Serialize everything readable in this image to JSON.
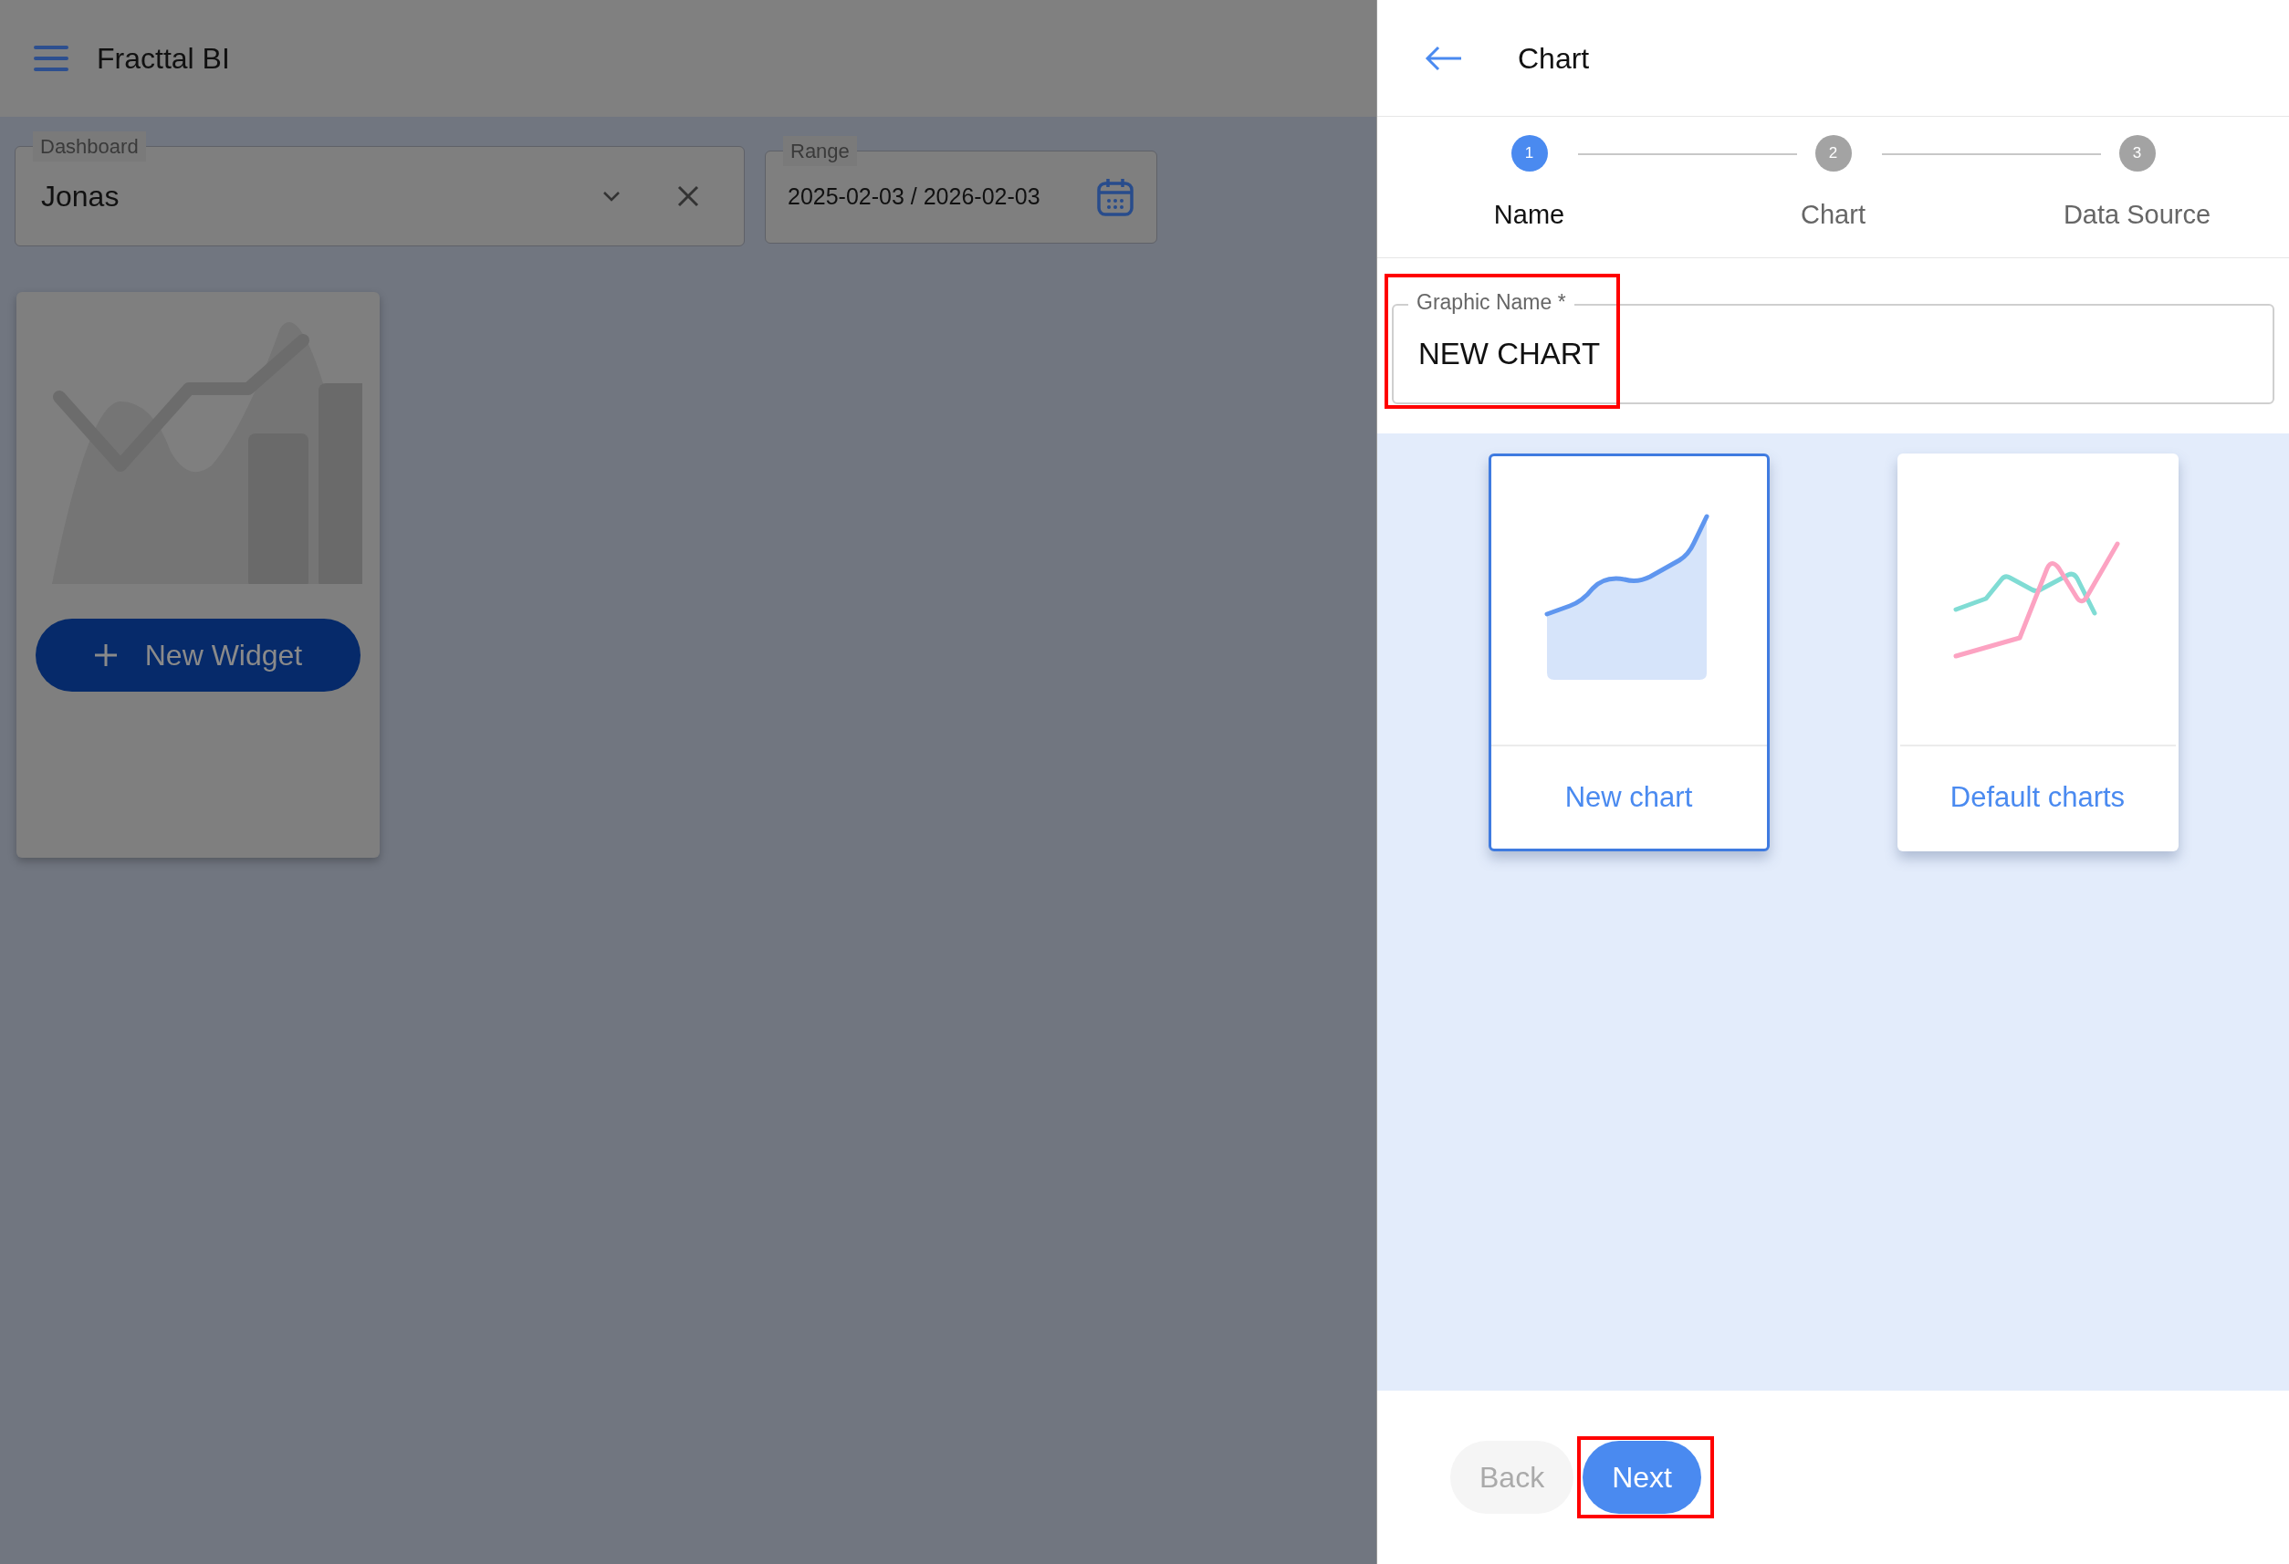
{
  "app": {
    "title": "Fracttal BI"
  },
  "filters": [
    {
      "label": "Dashboard",
      "value": "Jonas",
      "kind": "select"
    },
    {
      "label": "Range",
      "value": "2025-02-03 / 2026-02-03",
      "kind": "date"
    }
  ],
  "widget_card": {
    "button": "New Widget"
  },
  "panel": {
    "title": "Chart",
    "steps": [
      {
        "number": "1",
        "label": "Name",
        "selected": true
      },
      {
        "number": "2",
        "label": "Chart",
        "selected": false
      },
      {
        "number": "3",
        "label": "Data Source",
        "selected": false
      }
    ],
    "field": {
      "label": "Graphic Name",
      "required_mark": "*",
      "value": "NEW CHART"
    },
    "options": [
      {
        "label": "New chart",
        "selected": true,
        "kind": "area"
      },
      {
        "label": "Default charts",
        "selected": false,
        "kind": "lines"
      }
    ],
    "buttons": [
      {
        "label": "Back",
        "disabled": true
      },
      {
        "label": "Next",
        "disabled": false
      }
    ]
  }
}
